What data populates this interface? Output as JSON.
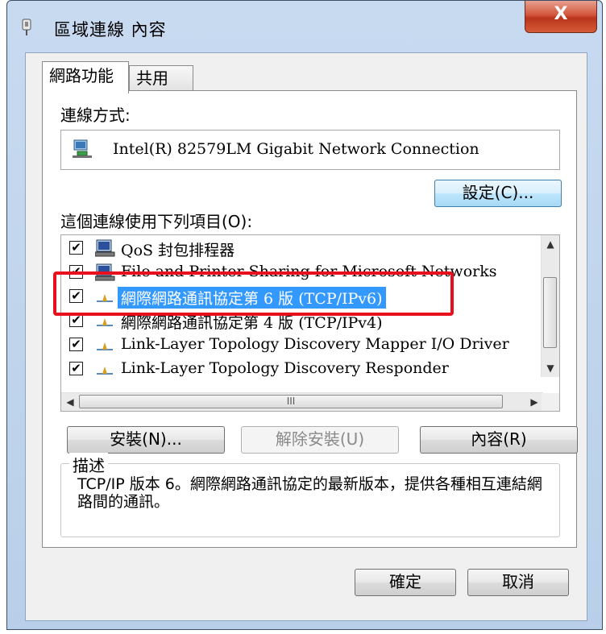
{
  "window": {
    "title": "區域連線 內容",
    "close_label": "X"
  },
  "tabs": [
    {
      "label": "網路功能"
    },
    {
      "label": "共用"
    }
  ],
  "connect_using": {
    "label": "連線方式:",
    "adapter_name": "Intel(R) 82579LM Gigabit Network Connection",
    "configure_label": "設定(C)..."
  },
  "items_section": {
    "label": "這個連線使用下列項目(O):",
    "items": [
      {
        "label": "QoS 封包排程器",
        "checked": true,
        "icon": "service-icon"
      },
      {
        "label": "File and Printer Sharing for Microsoft Networks",
        "checked": true,
        "icon": "service-icon"
      },
      {
        "label": "網際網路通訊協定第 6 版 (TCP/IPv6)",
        "checked": true,
        "icon": "protocol-icon",
        "selected": true
      },
      {
        "label": "網際網路通訊協定第 4 版 (TCP/IPv4)",
        "checked": true,
        "icon": "protocol-icon"
      },
      {
        "label": "Link-Layer Topology Discovery Mapper I/O Driver",
        "checked": true,
        "icon": "protocol-icon"
      },
      {
        "label": "Link-Layer Topology Discovery Responder",
        "checked": true,
        "icon": "protocol-icon"
      }
    ],
    "check_mark": "✔",
    "scroll_grip": "III"
  },
  "buttons": {
    "install": "安裝(N)...",
    "uninstall": "解除安裝(U)",
    "properties": "內容(R)",
    "ok": "確定",
    "cancel": "取消"
  },
  "description": {
    "title": "描述",
    "text": "TCP/IP 版本 6。網際網路通訊協定的最新版本，提供各種相互連結網路間的通訊。"
  },
  "colors": {
    "selection": "#3399ff",
    "annotation": "#e8101c"
  }
}
